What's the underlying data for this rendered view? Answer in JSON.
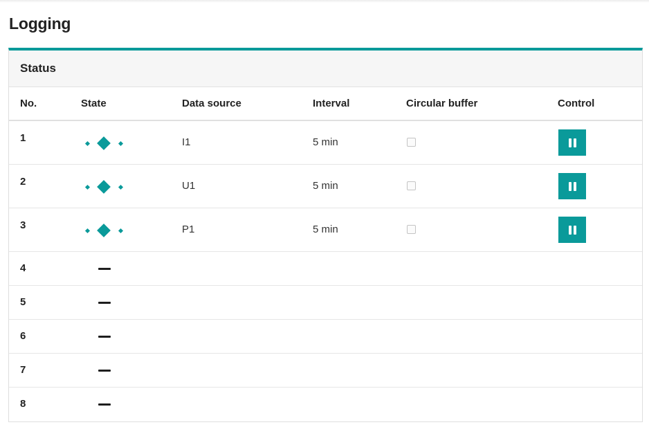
{
  "page": {
    "title": "Logging"
  },
  "panel": {
    "title": "Status"
  },
  "table": {
    "columns": {
      "no": "No.",
      "state": "State",
      "data_source": "Data source",
      "interval": "Interval",
      "circular_buffer": "Circular buffer",
      "control": "Control"
    },
    "rows": [
      {
        "no": "1",
        "state": "running",
        "data_source": "I1",
        "interval": "5 min",
        "circular_buffer": false,
        "control": "pause"
      },
      {
        "no": "2",
        "state": "running",
        "data_source": "U1",
        "interval": "5 min",
        "circular_buffer": false,
        "control": "pause"
      },
      {
        "no": "3",
        "state": "running",
        "data_source": "P1",
        "interval": "5 min",
        "circular_buffer": false,
        "control": "pause"
      },
      {
        "no": "4",
        "state": "inactive"
      },
      {
        "no": "5",
        "state": "inactive"
      },
      {
        "no": "6",
        "state": "inactive"
      },
      {
        "no": "7",
        "state": "inactive"
      },
      {
        "no": "8",
        "state": "inactive"
      }
    ]
  },
  "icons": {
    "running": "running-state-icon",
    "inactive": "inactive-dash-icon",
    "pause": "pause-icon"
  },
  "colors": {
    "accent": "#0a9a9a",
    "header_bg": "#f6f6f6",
    "dash": "#1e1e1e"
  }
}
